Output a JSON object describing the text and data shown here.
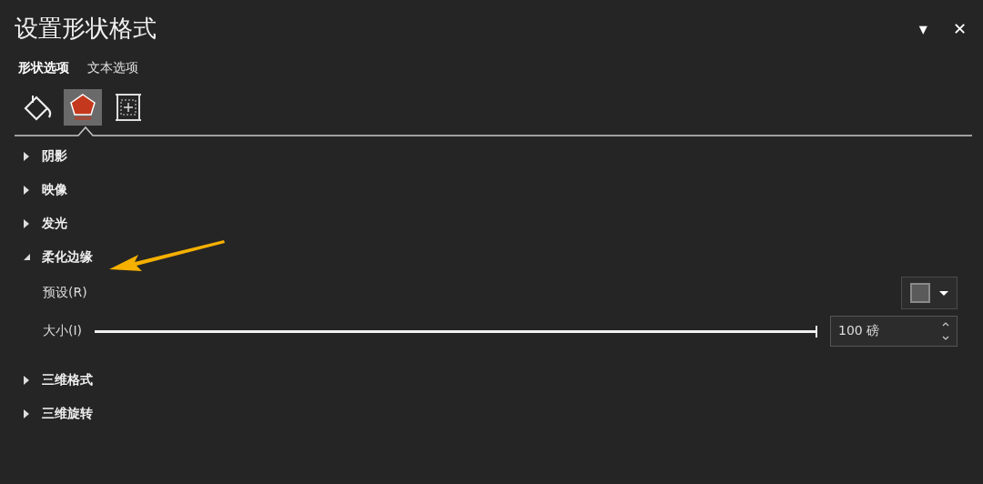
{
  "panel": {
    "title": "设置形状格式",
    "menu_glyph": "▾",
    "close_glyph": "✕"
  },
  "tabs": [
    {
      "label": "形状选项",
      "selected": true
    },
    {
      "label": "文本选项",
      "selected": false
    }
  ],
  "icon_tabs": [
    {
      "kind": "fill",
      "selected": false
    },
    {
      "kind": "effects",
      "selected": true
    },
    {
      "kind": "layout",
      "selected": false
    }
  ],
  "sections": [
    {
      "label": "阴影",
      "expanded": false
    },
    {
      "label": "映像",
      "expanded": false
    },
    {
      "label": "发光",
      "expanded": false
    },
    {
      "label": "柔化边缘",
      "expanded": true,
      "settings": [
        {
          "kind": "preset",
          "label": "预设(R)"
        },
        {
          "kind": "slider",
          "label": "大小(I)",
          "level": 1,
          "value": "100 磅"
        }
      ]
    },
    {
      "label": "三维格式",
      "expanded": false
    },
    {
      "label": "三维旋转",
      "expanded": false
    }
  ]
}
